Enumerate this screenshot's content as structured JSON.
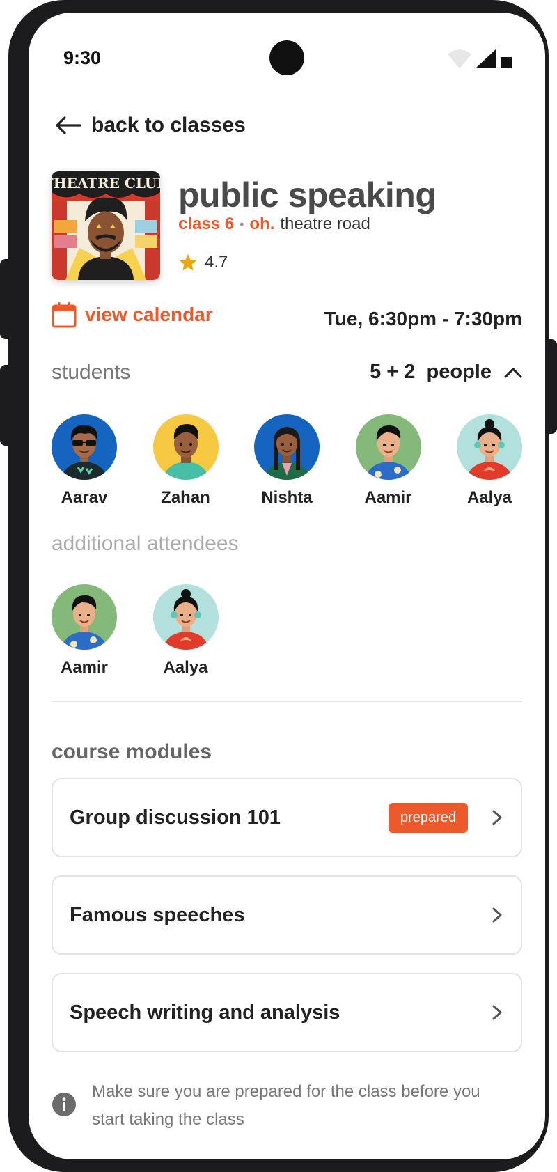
{
  "status_bar": {
    "time": "9:30"
  },
  "nav": {
    "back_label": "back to classes"
  },
  "class": {
    "title": "public speaking",
    "class_level": "class 6",
    "brand": "oh.",
    "location": "theatre road",
    "rating": "4.7",
    "cover_text": "THEATRE CLUB"
  },
  "schedule": {
    "calendar_label": "view calendar",
    "time_range": "Tue, 6:30pm - 7:30pm"
  },
  "students": {
    "label": "students",
    "count": "5 + 2  people",
    "list": [
      {
        "name": "Aarav",
        "bg": "#1565c0"
      },
      {
        "name": "Zahan",
        "bg": "#f7c842"
      },
      {
        "name": "Nishta",
        "bg": "#1565c0"
      },
      {
        "name": "Aamir",
        "bg": "#84b979"
      },
      {
        "name": "Aalya",
        "bg": "#b2e0dd"
      }
    ]
  },
  "additional": {
    "label": "additional attendees",
    "list": [
      {
        "name": "Aamir",
        "bg": "#84b979"
      },
      {
        "name": "Aalya",
        "bg": "#b2e0dd"
      }
    ]
  },
  "modules": {
    "label": "course modules",
    "items": [
      {
        "name": "Group discussion 101",
        "badge": "prepared"
      },
      {
        "name": "Famous speeches"
      },
      {
        "name": "Speech writing and analysis"
      }
    ]
  },
  "info": {
    "text": "Make sure you are prepared for the class before you start taking the class"
  },
  "colors": {
    "accent": "#ec5a2c",
    "star": "#e8a812"
  }
}
